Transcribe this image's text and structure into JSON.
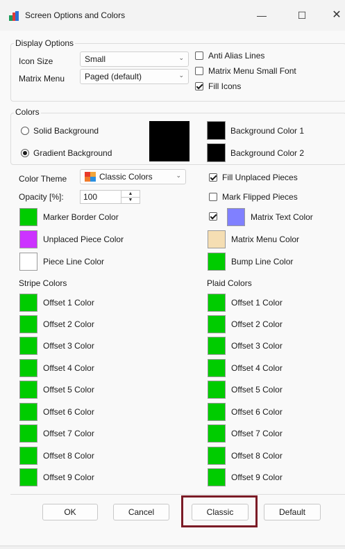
{
  "window": {
    "title": "Screen Options and Colors",
    "min_glyph": "—",
    "max_glyph": "☐",
    "close_glyph": "✕"
  },
  "display_options": {
    "label": "Display Options",
    "icon_size": {
      "label": "Icon Size",
      "value": "Small"
    },
    "matrix_menu": {
      "label": "Matrix Menu",
      "value": "Paged (default)"
    },
    "anti_alias": {
      "label": "Anti Alias Lines",
      "checked": false
    },
    "matrix_small_font": {
      "label": "Matrix Menu Small Font",
      "checked": false
    },
    "fill_icons": {
      "label": "Fill Icons",
      "checked": true
    }
  },
  "colors": {
    "label": "Colors",
    "solid_background": {
      "label": "Solid Background",
      "selected": false
    },
    "gradient_background": {
      "label": "Gradient Background",
      "selected": true
    },
    "background_color_1": {
      "label": "Background Color 1",
      "color": "#000000"
    },
    "background_color_2": {
      "label": "Background Color 2",
      "color": "#000000"
    },
    "preview_color": "#000000"
  },
  "color_theme": {
    "label": "Color Theme",
    "value": "Classic Colors"
  },
  "opacity": {
    "label": "Opacity [%]:",
    "value": "100"
  },
  "fill_unplaced": {
    "label": "Fill Unplaced Pieces",
    "checked": true
  },
  "mark_flipped": {
    "label": "Mark Flipped Pieces",
    "checked": false
  },
  "marker_border": {
    "label": "Marker Border Color",
    "color": "#00cc00"
  },
  "matrix_text": {
    "label": "Matrix Text Color",
    "color": "#8080ff",
    "checked": true
  },
  "unplaced_piece": {
    "label": "Unplaced Piece Color",
    "color": "#cc33ff"
  },
  "matrix_menu_color": {
    "label": "Matrix Menu Color",
    "color": "#f5deb3"
  },
  "piece_line": {
    "label": "Piece Line Color",
    "color": "#ffffff"
  },
  "bump_line": {
    "label": "Bump Line Color",
    "color": "#00cc00"
  },
  "stripe": {
    "label": "Stripe Colors",
    "items": [
      {
        "label": "Offset 1 Color",
        "color": "#00cc00"
      },
      {
        "label": "Offset 2 Color",
        "color": "#00cc00"
      },
      {
        "label": "Offset 3 Color",
        "color": "#00cc00"
      },
      {
        "label": "Offset 4 Color",
        "color": "#00cc00"
      },
      {
        "label": "Offset 5 Color",
        "color": "#00cc00"
      },
      {
        "label": "Offset 6 Color",
        "color": "#00cc00"
      },
      {
        "label": "Offset 7 Color",
        "color": "#00cc00"
      },
      {
        "label": "Offset 8 Color",
        "color": "#00cc00"
      },
      {
        "label": "Offset 9 Color",
        "color": "#00cc00"
      }
    ]
  },
  "plaid": {
    "label": "Plaid Colors",
    "items": [
      {
        "label": "Offset 1 Color",
        "color": "#00cc00"
      },
      {
        "label": "Offset 2 Color",
        "color": "#00cc00"
      },
      {
        "label": "Offset 3 Color",
        "color": "#00cc00"
      },
      {
        "label": "Offset 4 Color",
        "color": "#00cc00"
      },
      {
        "label": "Offset 5 Color",
        "color": "#00cc00"
      },
      {
        "label": "Offset 6 Color",
        "color": "#00cc00"
      },
      {
        "label": "Offset 7 Color",
        "color": "#00cc00"
      },
      {
        "label": "Offset 8 Color",
        "color": "#00cc00"
      },
      {
        "label": "Offset 9 Color",
        "color": "#00cc00"
      }
    ]
  },
  "buttons": {
    "ok": "OK",
    "cancel": "Cancel",
    "classic": "Classic",
    "default": "Default"
  },
  "accent": {
    "highlight": "#7b1b26"
  }
}
